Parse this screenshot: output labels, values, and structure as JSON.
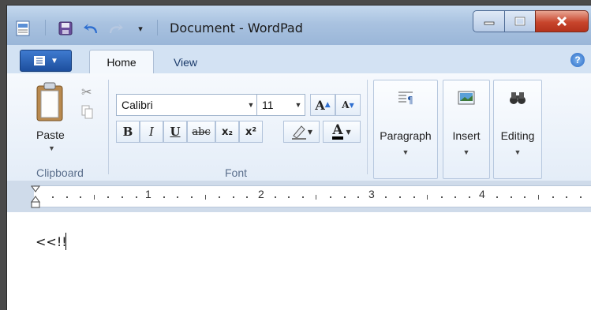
{
  "window": {
    "title": "Document - WordPad"
  },
  "tabs": [
    {
      "label": "Home"
    },
    {
      "label": "View"
    }
  ],
  "help": {
    "label": "?"
  },
  "clipboard": {
    "paste_label": "Paste",
    "group_label": "Clipboard"
  },
  "font": {
    "family": "Calibri",
    "size": "11",
    "group_label": "Font",
    "grow_label": "A",
    "shrink_label": "A",
    "bold_label": "B",
    "italic_label": "I",
    "underline_label": "U",
    "strike_label": "abc",
    "subscript_label": "x₂",
    "superscript_label": "x²",
    "color_label": "A"
  },
  "groups": {
    "paragraph_label": "Paragraph",
    "insert_label": "Insert",
    "editing_label": "Editing"
  },
  "ruler": {
    "numbers": [
      "1",
      "2",
      "3",
      "4"
    ]
  },
  "document": {
    "text": "<<!!"
  },
  "colors": {
    "title_bar": "#a9c2e0",
    "ribbon": "#f6f9fd",
    "app_button": "#2a5fb5",
    "close_button": "#c8452c",
    "font_color": "#000000"
  },
  "icons": [
    "app-icon",
    "save-icon",
    "undo-icon",
    "redo-icon",
    "clipboard-icon",
    "scissors-icon",
    "copy-icon",
    "highlighter-icon",
    "paragraph-icon",
    "picture-icon",
    "binoculars-icon",
    "help-icon"
  ]
}
